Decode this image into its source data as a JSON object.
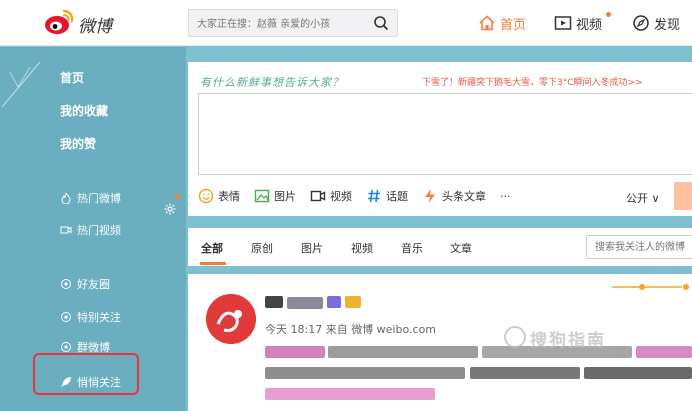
{
  "header": {
    "logo_text": "微博",
    "search_placeholder": "大家正在搜：赵薇 亲爱的小孩",
    "nav": {
      "home": "首页",
      "video": "视频",
      "discover": "发现"
    },
    "accent": "#fa7d3c"
  },
  "sidebar": {
    "items": [
      {
        "label": "首页"
      },
      {
        "label": "我的收藏"
      },
      {
        "label": "我的赞"
      },
      {
        "label": "热门微博"
      },
      {
        "label": "热门视频"
      },
      {
        "label": "好友圈"
      },
      {
        "label": "特别关注"
      },
      {
        "label": "群微博"
      },
      {
        "label": "悄悄关注"
      }
    ]
  },
  "publisher": {
    "prompt": "有什么新鲜事想告诉大家？",
    "hot_news": "下雪了！新疆突下鹅毛大雪，零下3°C瞬间入冬成功>>",
    "tools": [
      {
        "label": "表情",
        "icon": "emoji-icon"
      },
      {
        "label": "图片",
        "icon": "image-icon"
      },
      {
        "label": "视频",
        "icon": "video-icon"
      },
      {
        "label": "话题",
        "icon": "hashtag-icon"
      },
      {
        "label": "头条文章",
        "icon": "article-icon"
      },
      {
        "label": "···",
        "icon": "more-icon"
      }
    ],
    "scope": "公开 ∨"
  },
  "feed_tabs": {
    "items": [
      "全部",
      "原创",
      "图片",
      "视频",
      "音乐",
      "文章"
    ],
    "search_placeholder": "搜索我关注人的微博"
  },
  "feed": {
    "meta": "今天 18:17 来自 微博 weibo.com",
    "watermark": "搜狗指南"
  }
}
